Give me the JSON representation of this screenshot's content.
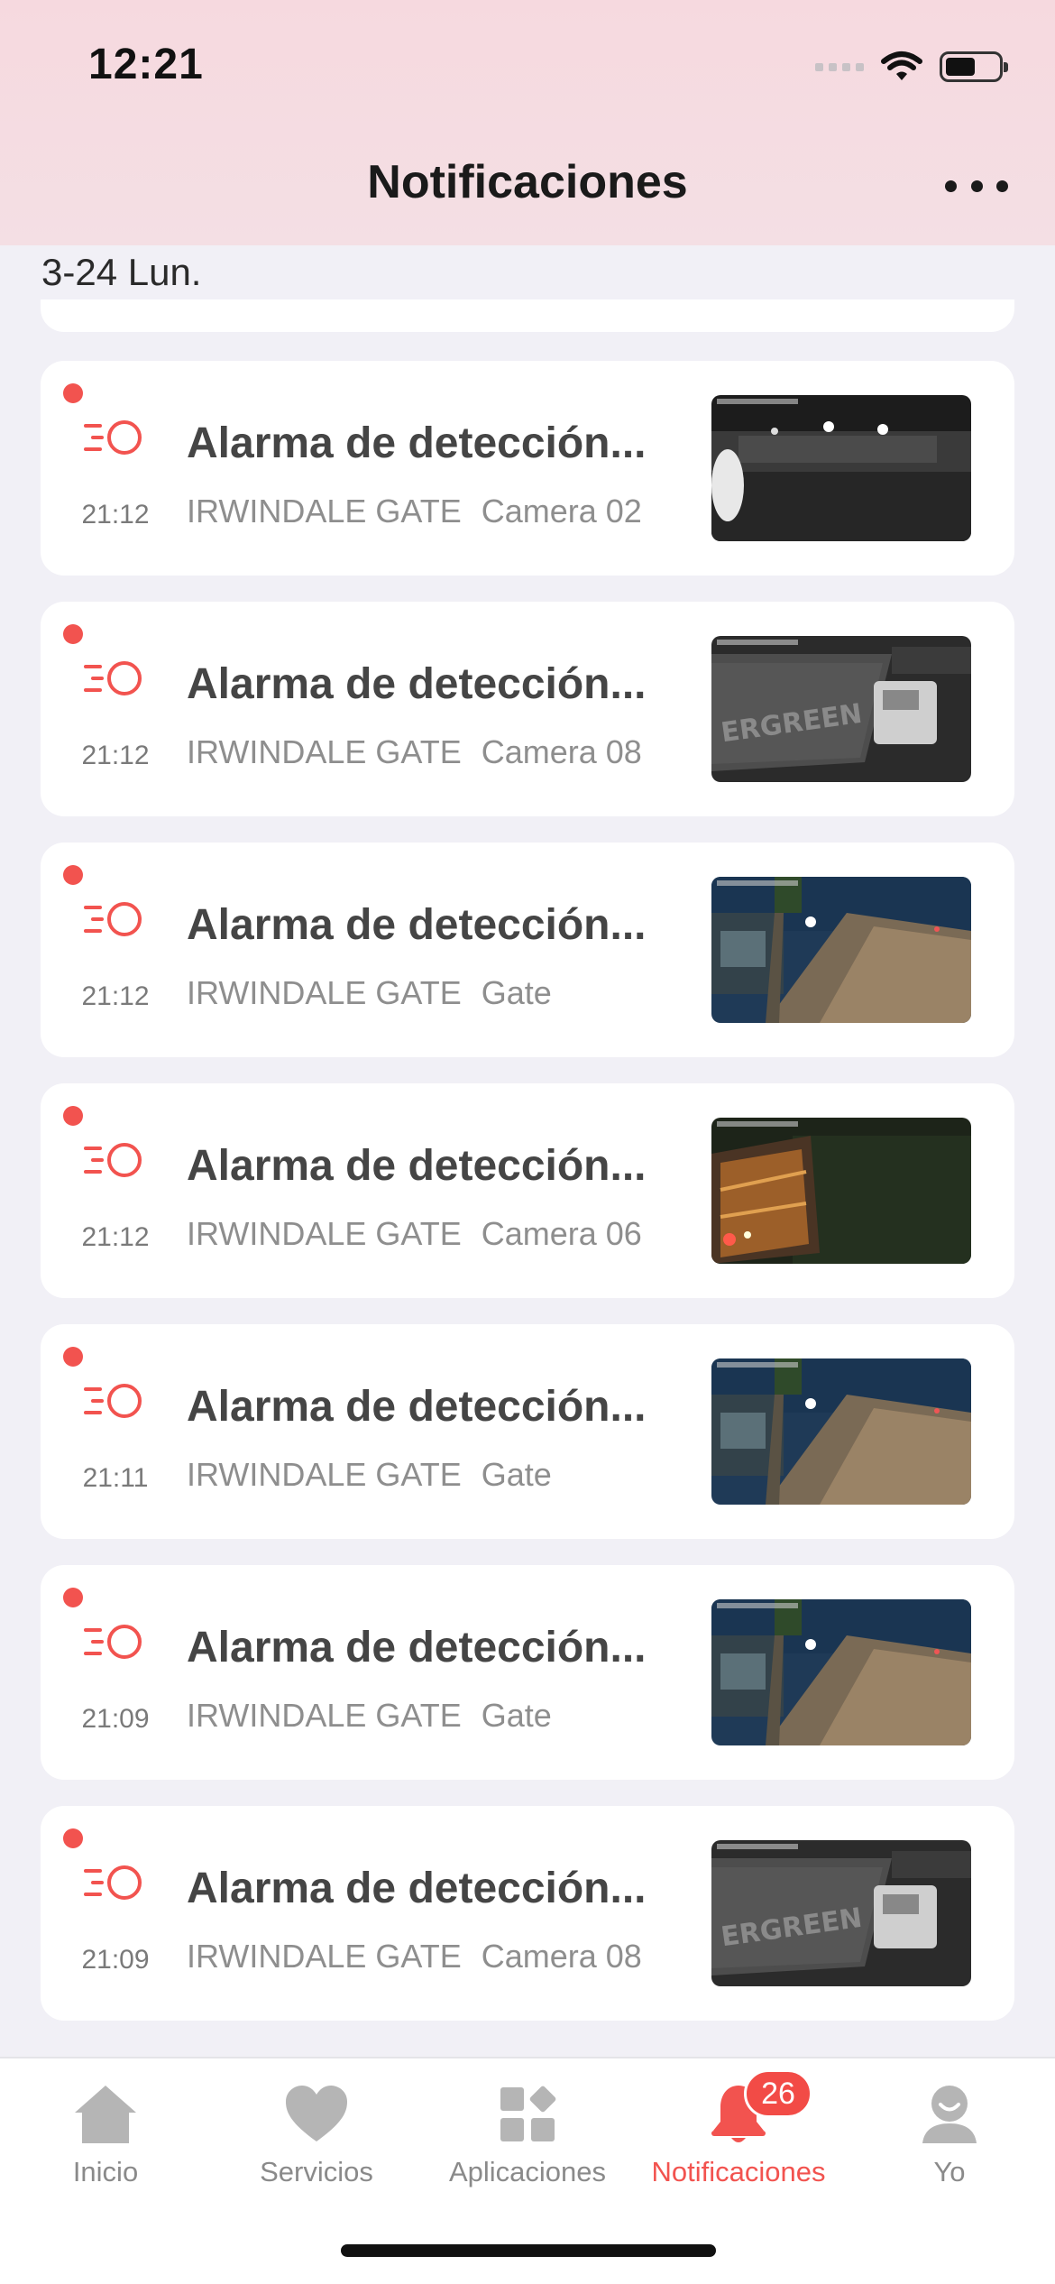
{
  "status_bar": {
    "time": "12:21"
  },
  "header": {
    "title": "Notificaciones",
    "more_icon": "more-dots-icon"
  },
  "date_header": "3-24 Lun.",
  "notifications": [
    {
      "title": "Alarma de detección...",
      "time": "21:12",
      "site": "IRWINDALE GATE",
      "camera": "Camera 02",
      "thumb": "night-lot"
    },
    {
      "title": "Alarma de detección...",
      "time": "21:12",
      "site": "IRWINDALE GATE",
      "camera": "Camera 08",
      "thumb": "container"
    },
    {
      "title": "Alarma de detección...",
      "time": "21:12",
      "site": "IRWINDALE GATE",
      "camera": "Gate",
      "thumb": "gate"
    },
    {
      "title": "Alarma de detección...",
      "time": "21:12",
      "site": "IRWINDALE GATE",
      "camera": "Camera 06",
      "thumb": "truck"
    },
    {
      "title": "Alarma de detección...",
      "time": "21:11",
      "site": "IRWINDALE GATE",
      "camera": "Gate",
      "thumb": "gate"
    },
    {
      "title": "Alarma de detección...",
      "time": "21:09",
      "site": "IRWINDALE GATE",
      "camera": "Gate",
      "thumb": "gate"
    },
    {
      "title": "Alarma de detección...",
      "time": "21:09",
      "site": "IRWINDALE GATE",
      "camera": "Camera 08",
      "thumb": "container"
    }
  ],
  "tabs": [
    {
      "label": "Inicio",
      "icon": "home-icon"
    },
    {
      "label": "Servicios",
      "icon": "heart-icon"
    },
    {
      "label": "Aplicaciones",
      "icon": "apps-icon"
    },
    {
      "label": "Notificaciones",
      "icon": "bell-icon",
      "badge": "26",
      "active": true
    },
    {
      "label": "Yo",
      "icon": "user-icon"
    }
  ],
  "colors": {
    "accent": "#f2534f",
    "header_bg": "#f6d9df",
    "page_bg": "#f1f0f6"
  }
}
